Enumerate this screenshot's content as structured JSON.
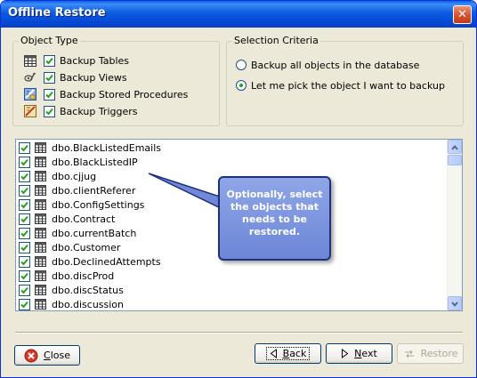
{
  "window": {
    "title": "Offline Restore",
    "close_glyph": "✕"
  },
  "object_type": {
    "legend": "Object Type",
    "items": [
      {
        "label": "Backup Tables",
        "icon": "table-icon",
        "checked": true
      },
      {
        "label": "Backup Views",
        "icon": "views-icon",
        "checked": true
      },
      {
        "label": "Backup Stored Procedures",
        "icon": "stored-procedure-icon",
        "checked": true
      },
      {
        "label": "Backup Triggers",
        "icon": "trigger-icon",
        "checked": true
      }
    ]
  },
  "selection_criteria": {
    "legend": "Selection Criteria",
    "options": [
      {
        "label": "Backup all objects in the database",
        "selected": false
      },
      {
        "label": "Let me pick the object I want to backup",
        "selected": true
      }
    ]
  },
  "objects": {
    "items": [
      {
        "name": "dbo.BlackListedEmails",
        "checked": true
      },
      {
        "name": "dbo.BlackListedIP",
        "checked": true
      },
      {
        "name": "dbo.cjjug",
        "checked": true
      },
      {
        "name": "dbo.clientReferer",
        "checked": true
      },
      {
        "name": "dbo.ConfigSettings",
        "checked": true
      },
      {
        "name": "dbo.Contract",
        "checked": true
      },
      {
        "name": "dbo.currentBatch",
        "checked": true
      },
      {
        "name": "dbo.Customer",
        "checked": true
      },
      {
        "name": "dbo.DeclinedAttempts",
        "checked": true
      },
      {
        "name": "dbo.discProd",
        "checked": true
      },
      {
        "name": "dbo.discStatus",
        "checked": true
      },
      {
        "name": "dbo.discussion",
        "checked": true
      }
    ]
  },
  "callout": {
    "text": "Optionally, select the objects that needs to be restored."
  },
  "buttons": {
    "close": {
      "mnemonic": "C",
      "rest": "lose"
    },
    "back": {
      "mnemonic": "B",
      "rest": "ack"
    },
    "next": {
      "mnemonic": "N",
      "rest": "ext"
    },
    "restore": {
      "label": "Restore",
      "enabled": false
    }
  },
  "colors": {
    "title_bar": "#0A5FE8",
    "callout_fill": "#7B93DD",
    "checkbox_check": "#21A121"
  }
}
